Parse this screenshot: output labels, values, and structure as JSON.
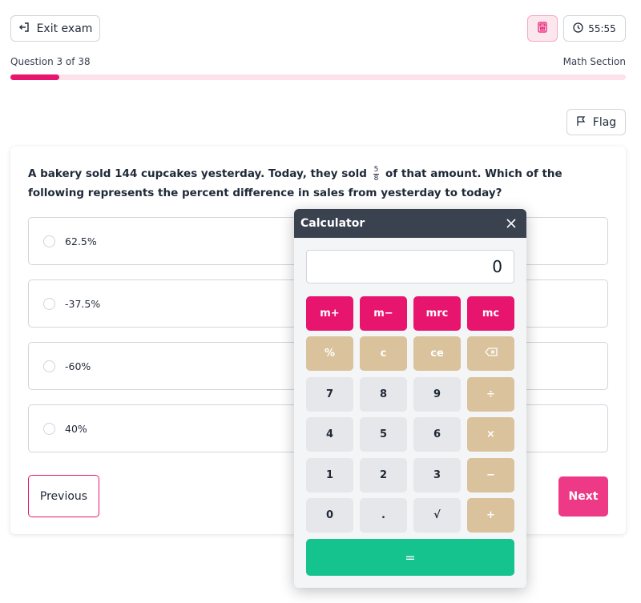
{
  "header": {
    "exit_label": "Exit exam",
    "exit_icon": "exit-icon",
    "calculator_icon": "calculator-icon",
    "timer_icon": "clock-icon",
    "timer": "55:55",
    "question_counter": "Question 3 of 38",
    "section": "Math Section",
    "progress_fraction": 0.08,
    "accent_color": "#e8156f"
  },
  "flag": {
    "label": "Flag",
    "icon": "flag-icon"
  },
  "question": {
    "text_before": "A bakery sold 144 cupcakes yesterday. Today, they sold",
    "fraction_numerator": "5",
    "fraction_denominator": "8",
    "text_after": "of that amount. Which of the following represents the percent difference in sales from yesterday to today?",
    "options": [
      "62.5%",
      "-37.5%",
      "-60%",
      "40%"
    ]
  },
  "nav": {
    "previous_label": "Previous",
    "next_label": "Next"
  },
  "calculator": {
    "title": "Calculator",
    "display": "0",
    "memory_keys": [
      "m+",
      "m−",
      "mrc",
      "mc"
    ],
    "function_keys": [
      "%",
      "c",
      "ce",
      "⌫"
    ],
    "rows": [
      [
        "7",
        "8",
        "9",
        "÷"
      ],
      [
        "4",
        "5",
        "6",
        "×"
      ],
      [
        "1",
        "2",
        "3",
        "−"
      ],
      [
        "0",
        ".",
        "√",
        "+"
      ]
    ],
    "equals": "=",
    "equals_color": "#14c38e"
  }
}
